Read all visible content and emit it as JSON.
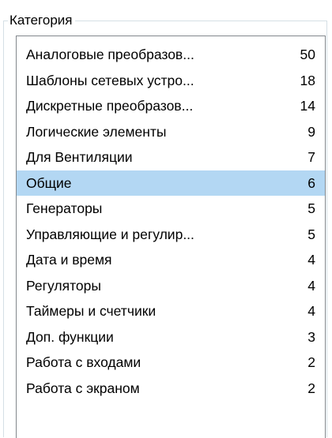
{
  "category_group": {
    "title": "Категория",
    "selected_index": 5,
    "items": [
      {
        "name": "Аналоговые преобразов...",
        "count": "50"
      },
      {
        "name": "Шаблоны сетевых устро...",
        "count": "18"
      },
      {
        "name": "Дискретные преобразов...",
        "count": "14"
      },
      {
        "name": "Логические элементы",
        "count": "9"
      },
      {
        "name": "Для Вентиляции",
        "count": "7"
      },
      {
        "name": "Общие",
        "count": "6"
      },
      {
        "name": "Генераторы",
        "count": "5"
      },
      {
        "name": "Управляющие и регулир...",
        "count": "5"
      },
      {
        "name": "Дата и время",
        "count": "4"
      },
      {
        "name": "Регуляторы",
        "count": "4"
      },
      {
        "name": "Таймеры и счетчики",
        "count": "4"
      },
      {
        "name": "Доп. функции",
        "count": "3"
      },
      {
        "name": "Работа с входами",
        "count": "2"
      },
      {
        "name": "Работа с экраном",
        "count": "2"
      }
    ]
  },
  "colors": {
    "selection": "#b3d7f3",
    "listbox_border": "#82878c",
    "groupbox_border": "#d5dfe5"
  }
}
